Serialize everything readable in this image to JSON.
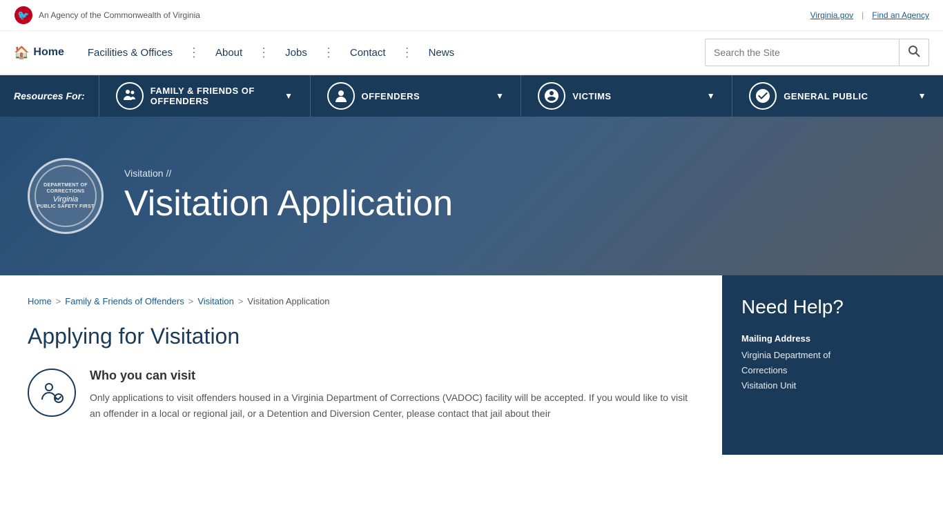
{
  "topbar": {
    "agency_text": "An Agency of the Commonwealth of Virginia",
    "virginia_gov_link": "Virginia.gov",
    "find_agency_link": "Find an Agency"
  },
  "nav": {
    "home_label": "Home",
    "facilities_label": "Facilities & Offices",
    "about_label": "About",
    "jobs_label": "Jobs",
    "contact_label": "Contact",
    "news_label": "News",
    "search_placeholder": "Search the Site"
  },
  "resources_bar": {
    "label": "Resources For:",
    "items": [
      {
        "id": "family-friends",
        "label": "FAMILY & FRIENDS OF OFFENDERS",
        "icon": "👨‍👩‍👧"
      },
      {
        "id": "offenders",
        "label": "OFFENDERS",
        "icon": "👤"
      },
      {
        "id": "victims",
        "label": "VICTIMS",
        "icon": "🤝"
      },
      {
        "id": "general-public",
        "label": "GENERAL PUBLIC",
        "icon": "🏛"
      }
    ]
  },
  "hero": {
    "seal_line1": "DEPARTMENT OF CORRECTIONS",
    "seal_virginia": "Virginia",
    "seal_tagline": "PUBLIC SAFETY FIRST",
    "breadcrumb": "Visitation //",
    "title": "Visitation Application"
  },
  "breadcrumb": {
    "items": [
      {
        "label": "Home",
        "href": "#"
      },
      {
        "label": "Family & Friends of Offenders",
        "href": "#"
      },
      {
        "label": "Visitation",
        "href": "#"
      },
      {
        "label": "Visitation Application",
        "href": "#",
        "current": true
      }
    ]
  },
  "main": {
    "heading": "Applying for Visitation",
    "who_visit": {
      "title": "Who you can visit",
      "text": "Only applications to visit offenders housed in a Virginia Department of Corrections (VADOC) facility will be accepted. If you would like to visit an offender in a local or regional jail, or a Detention and Diversion Center, please contact that jail about their"
    }
  },
  "sidebar": {
    "heading": "Need Help?",
    "mailing_address_label": "Mailing Address",
    "address_line1": "Virginia Department of",
    "address_line2": "Corrections",
    "address_line3": "Visitation Unit"
  }
}
